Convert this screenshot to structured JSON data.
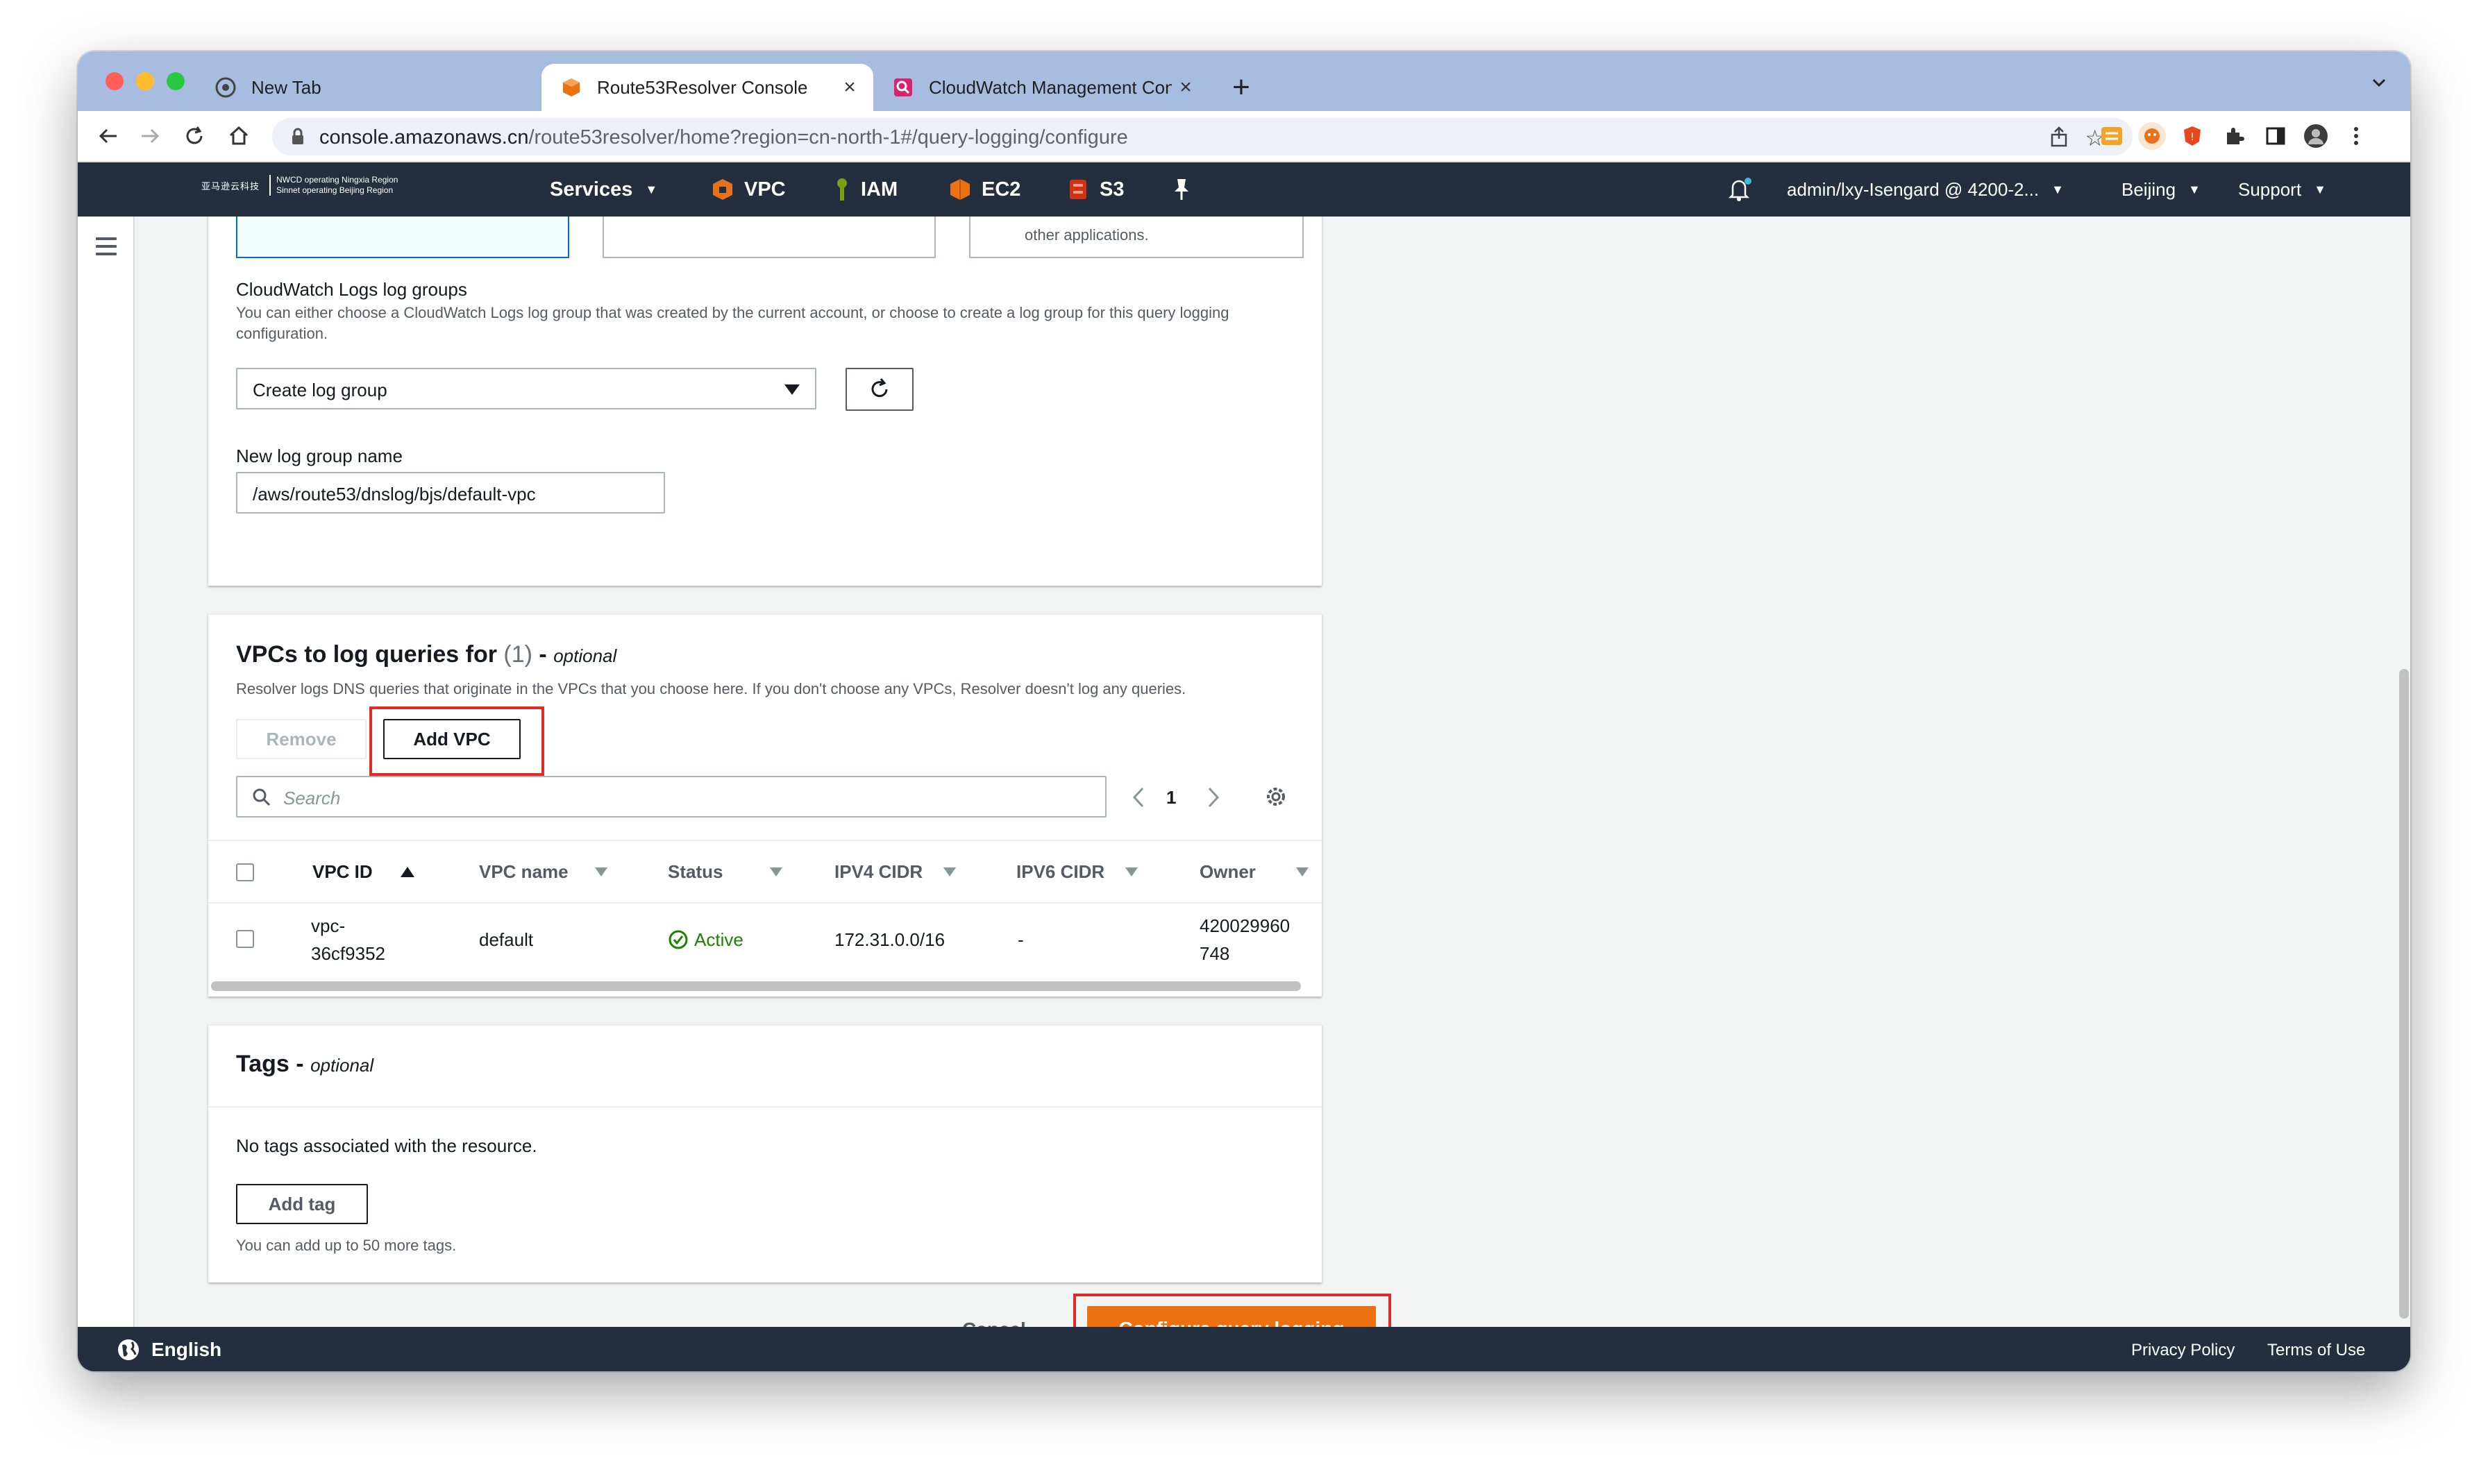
{
  "browser": {
    "tabs": [
      {
        "title": "New Tab",
        "favicon": "chrome-icon"
      },
      {
        "title": "Route53Resolver Console",
        "favicon": "aws-cube-icon"
      },
      {
        "title": "CloudWatch Management Con",
        "favicon": "cloudwatch-icon"
      }
    ],
    "new_tab": "+",
    "url_host": "console.amazonaws.cn",
    "url_path": "/route53resolver/home?region=cn-north-1#/query-logging/configure"
  },
  "aws_nav": {
    "logo_cn": "亚马逊云科技",
    "logo_line1": "NWCD operating Ningxia Region",
    "logo_line2": "Sinnet operating Beijing Region",
    "services": "Services",
    "shortcuts": [
      "VPC",
      "IAM",
      "EC2",
      "S3"
    ],
    "account": "admin/lxy-Isengard @ 4200-2...",
    "region": "Beijing",
    "support": "Support"
  },
  "destination_tiles": {
    "third_tile_text": "other applications."
  },
  "log_groups": {
    "label": "CloudWatch Logs log groups",
    "description": "You can either choose a CloudWatch Logs log group that was created by the current account, or choose to create a log group for this query logging configuration.",
    "select_value": "Create log group",
    "new_name_label": "New log group name",
    "new_name_value": "/aws/route53/dnslog/bjs/default-vpc"
  },
  "vpcs": {
    "title": "VPCs to log queries for",
    "count": "(1)",
    "optional": "optional",
    "description": "Resolver logs DNS queries that originate in the VPCs that you choose here. If you don't choose any VPCs, Resolver doesn't log any queries.",
    "remove_label": "Remove",
    "add_label": "Add VPC",
    "search_placeholder": "Search",
    "page": "1",
    "columns": [
      "VPC ID",
      "VPC name",
      "Status",
      "IPV4 CIDR",
      "IPV6 CIDR",
      "Owner"
    ],
    "rows": [
      {
        "vpc_id_1": "vpc-",
        "vpc_id_2": "36cf9352",
        "name": "default",
        "status": "Active",
        "ipv4": "172.31.0.0/16",
        "ipv6": "-",
        "owner_1": "420029960",
        "owner_2": "748"
      }
    ]
  },
  "tags": {
    "title": "Tags",
    "optional": "optional",
    "empty": "No tags associated with the resource.",
    "add_label": "Add tag",
    "hint": "You can add up to 50 more tags."
  },
  "actions": {
    "cancel": "Cancel",
    "submit": "Configure query logging"
  },
  "footer": {
    "language": "English",
    "privacy": "Privacy Policy",
    "terms": "Terms of Use"
  },
  "colors": {
    "aws_nav": "#232f3e",
    "primary": "#ec7211",
    "success": "#1d8102",
    "highlight": "#e02b2b"
  }
}
